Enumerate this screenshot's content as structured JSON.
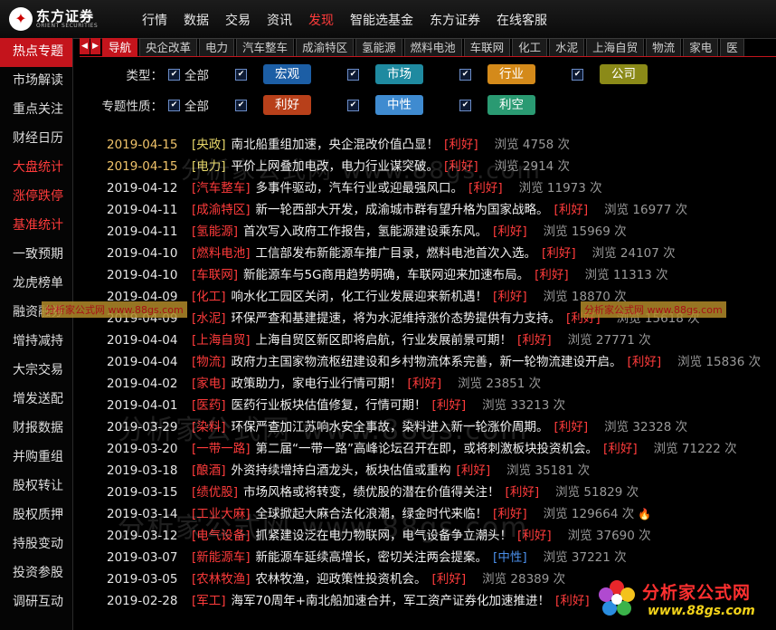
{
  "topbar": {
    "logo_cn": "东方证券",
    "logo_en": "ORIENT SECURITIES",
    "nav": [
      "行情",
      "数据",
      "交易",
      "资讯",
      "发现",
      "智能选基金",
      "东方证券",
      "在线客服"
    ],
    "active_nav": "发现"
  },
  "sidebar": {
    "items": [
      "热点专题",
      "市场解读",
      "重点关注",
      "财经日历",
      "大盘统计",
      "涨停跌停",
      "基准统计",
      "一致预期",
      "龙虎榜单",
      "融资融券",
      "增持减持",
      "大宗交易",
      "增发送配",
      "财报数据",
      "并购重组",
      "股权转让",
      "股权质押",
      "持股变动",
      "投资参股",
      "调研互动"
    ],
    "active": "热点专题",
    "red_items": [
      "大盘统计",
      "涨停跌停",
      "基准统计"
    ]
  },
  "subtabs": {
    "items": [
      "导航",
      "央企改革",
      "电力",
      "汽车整车",
      "成渝特区",
      "氢能源",
      "燃料电池",
      "车联网",
      "化工",
      "水泥",
      "上海自贸",
      "物流",
      "家电",
      "医"
    ],
    "active": "导航"
  },
  "filters": {
    "type_label": "类型：",
    "type_all": "全部",
    "types": [
      "宏观",
      "市场",
      "行业",
      "公司"
    ],
    "nature_label": "专题性质：",
    "nature_all": "全部",
    "natures": [
      "利好",
      "中性",
      "利空"
    ]
  },
  "news": [
    {
      "date": "2019-04-15",
      "cat": "[央政]",
      "title": "南北船重组加速，央企混改价值凸显！",
      "tag": "[利好]",
      "views": "浏览 4758 次",
      "hl": true
    },
    {
      "date": "2019-04-15",
      "cat": "[电力]",
      "title": "平价上网叠加电改，电力行业谋突破。",
      "tag": "[利好]",
      "views": "浏览 2914 次",
      "hl": true
    },
    {
      "date": "2019-04-12",
      "cat": "[汽车整车]",
      "title": "多事件驱动，汽车行业或迎最强风口。",
      "tag": "[利好]",
      "views": "浏览 11973 次"
    },
    {
      "date": "2019-04-11",
      "cat": "[成渝特区]",
      "title": "新一轮西部大开发，成渝城市群有望升格为国家战略。",
      "tag": "[利好]",
      "views": "浏览 16977 次"
    },
    {
      "date": "2019-04-11",
      "cat": "[氢能源]",
      "title": "首次写入政府工作报告，氢能源建设乘东风。",
      "tag": "[利好]",
      "views": "浏览 15969 次"
    },
    {
      "date": "2019-04-10",
      "cat": "[燃料电池]",
      "title": "工信部发布新能源车推广目录，燃料电池首次入选。",
      "tag": "[利好]",
      "views": "浏览 24107 次"
    },
    {
      "date": "2019-04-10",
      "cat": "[车联网]",
      "title": "新能源车与5G商用趋势明确，车联网迎来加速布局。",
      "tag": "[利好]",
      "views": "浏览 11313 次"
    },
    {
      "date": "2019-04-09",
      "cat": "[化工]",
      "title": "响水化工园区关闭，化工行业发展迎来新机遇！",
      "tag": "[利好]",
      "views": "浏览 18870 次"
    },
    {
      "date": "2019-04-09",
      "cat": "[水泥]",
      "title": "环保严查和基建提速，将为水泥维持涨价态势提供有力支持。",
      "tag": "[利好]",
      "views": "浏览 15618 次"
    },
    {
      "date": "2019-04-04",
      "cat": "[上海自贸]",
      "title": "上海自贸区新区即将启航，行业发展前景可期！",
      "tag": "[利好]",
      "views": "浏览 27771 次"
    },
    {
      "date": "2019-04-04",
      "cat": "[物流]",
      "title": "政府力主国家物流枢纽建设和乡村物流体系完善，新一轮物流建设开启。",
      "tag": "[利好]",
      "views": "浏览 15836 次"
    },
    {
      "date": "2019-04-02",
      "cat": "[家电]",
      "title": "政策助力，家电行业行情可期！",
      "tag": "[利好]",
      "views": "浏览 23851 次"
    },
    {
      "date": "2019-04-01",
      "cat": "[医药]",
      "title": "医药行业板块估值修复，行情可期！",
      "tag": "[利好]",
      "views": "浏览 33213 次"
    },
    {
      "date": "2019-03-29",
      "cat": "[染料]",
      "title": "环保严查加江苏响水安全事故，染料进入新一轮涨价周期。",
      "tag": "[利好]",
      "views": "浏览 32328 次"
    },
    {
      "date": "2019-03-20",
      "cat": "[一带一路]",
      "title": "第二届“一带一路”高峰论坛召开在即，或将刺激板块投资机会。",
      "tag": "[利好]",
      "views": "浏览 71222 次"
    },
    {
      "date": "2019-03-18",
      "cat": "[酿酒]",
      "title": "外资持续增持白酒龙头，板块估值或重构",
      "tag": "[利好]",
      "views": "浏览 35181 次"
    },
    {
      "date": "2019-03-15",
      "cat": "[绩优股]",
      "title": "市场风格或将转变，绩优股的潜在价值得关注！",
      "tag": "[利好]",
      "views": "浏览 51829 次"
    },
    {
      "date": "2019-03-14",
      "cat": "[工业大麻]",
      "title": "全球掀起大麻合法化浪潮，绿金时代来临！",
      "tag": "[利好]",
      "views": "浏览 129664 次",
      "fire": true
    },
    {
      "date": "2019-03-12",
      "cat": "[电气设备]",
      "title": "抓紧建设泛在电力物联网，电气设备争立潮头！",
      "tag": "[利好]",
      "views": "浏览 37690 次"
    },
    {
      "date": "2019-03-07",
      "cat": "[新能源车]",
      "title": "新能源车延续高增长，密切关注两会提案。",
      "tag": "[中性]",
      "views": "浏览 37221 次",
      "neutral": true
    },
    {
      "date": "2019-03-05",
      "cat": "[农林牧渔]",
      "title": "农林牧渔，迎政策性投资机会。",
      "tag": "[利好]",
      "views": "浏览 28389 次"
    },
    {
      "date": "2019-02-28",
      "cat": "[军工]",
      "title": "海军70周年+南北船加速合并，军工资产证券化加速推进！",
      "tag": "[利好]",
      "views": ""
    }
  ],
  "watermark": {
    "large_1": "分析家公式网 www.88gs.com",
    "large_2": "分析家公式网 www.88gs.com",
    "large_3": "分析家公式网 www.88gs.com",
    "small_1": "分析家公式网 www.88gs.com",
    "small_2": "分析家公式网 www.88gs.com",
    "corner_cn": "分析家公式网",
    "corner_url": "www.88gs.com"
  },
  "colors": {
    "accent_red": "#c4141c",
    "highlight_date": "#f0c36a"
  }
}
